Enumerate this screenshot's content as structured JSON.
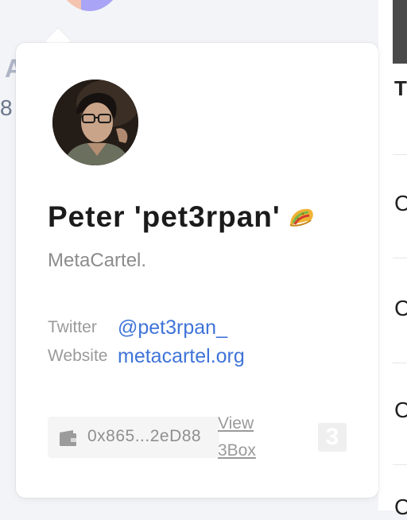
{
  "background": {
    "left_letter": "A",
    "left_digit": "8",
    "right_header_fragment": "Tr",
    "right_row_fragments": [
      "C",
      "C",
      "C",
      "C"
    ]
  },
  "profile": {
    "name": "Peter 'pet3rpan'",
    "emoji_icon": "taco-icon",
    "description": "MetaCartel.",
    "twitter_label": "Twitter",
    "twitter_handle": "@pet3rpan_",
    "website_label": "Website",
    "website_url": "metacartel.org",
    "address": "0x865...2eD88",
    "view_label": "View 3Box",
    "box_logo": "3"
  },
  "colors": {
    "link": "#3f74d8",
    "muted_text": "#9a9a9a",
    "name_text": "#1b1b1b"
  }
}
